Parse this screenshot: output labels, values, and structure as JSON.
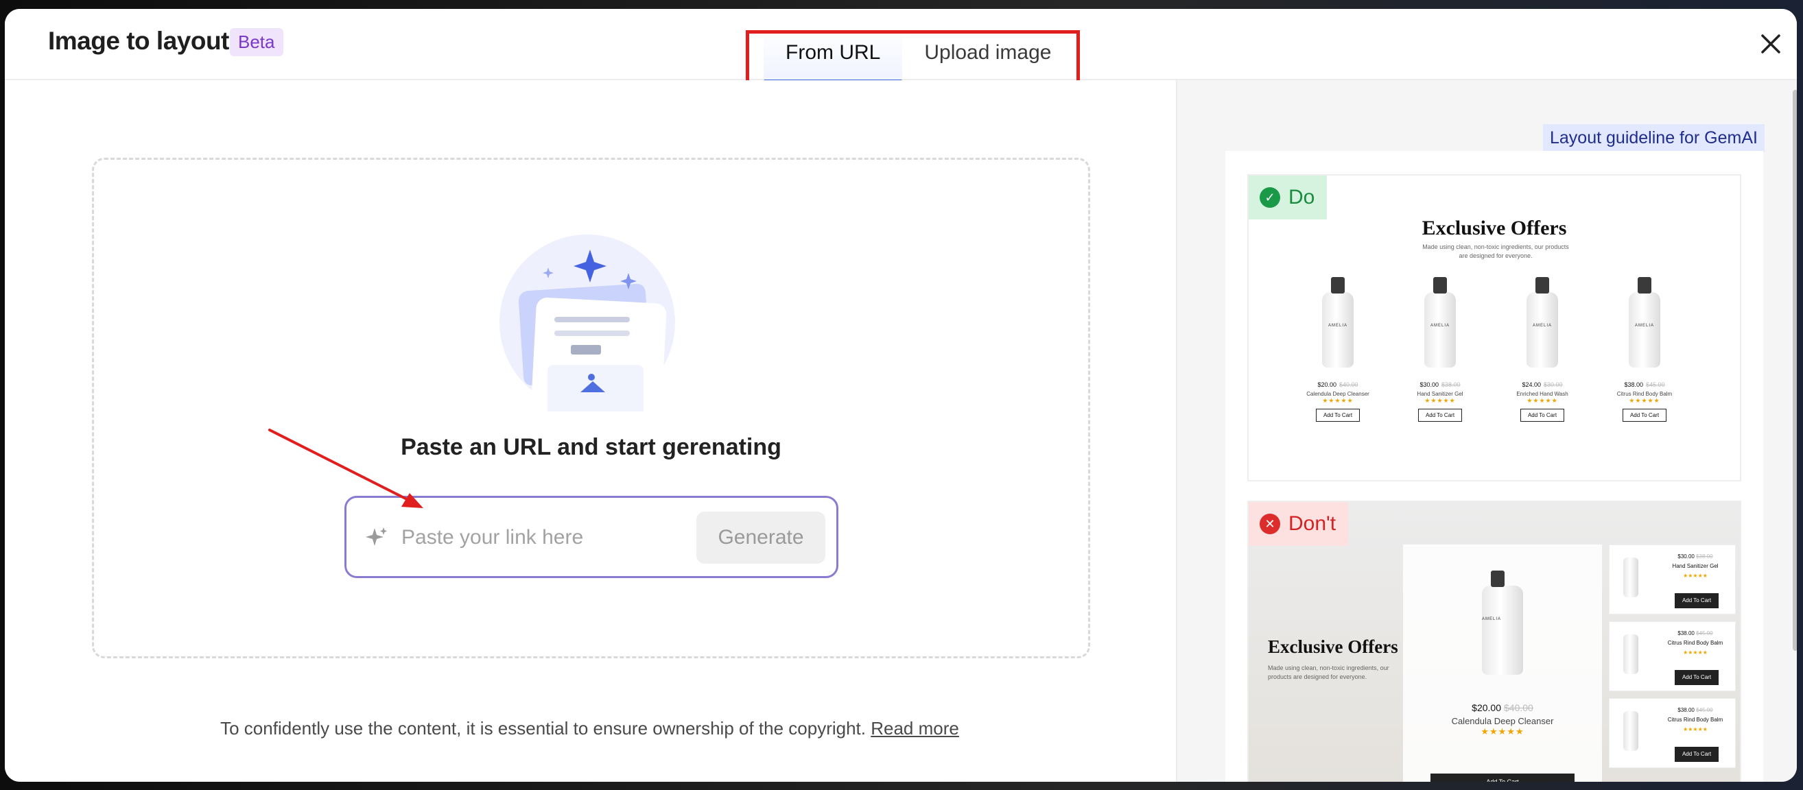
{
  "header": {
    "title": "Image to layout",
    "badge": "Beta",
    "tabs": [
      {
        "label": "From URL",
        "active": true
      },
      {
        "label": "Upload image",
        "active": false
      }
    ],
    "close_icon": "close-icon"
  },
  "main": {
    "prompt": "Paste an URL and start gerenating",
    "input_placeholder": "Paste your link here",
    "input_value": "",
    "generate_label": "Generate",
    "footer_text": "To confidently use the content, it is essential to ensure ownership of the copyright.",
    "footer_link": "Read more"
  },
  "guideline": {
    "label": "Layout guideline for GemAI",
    "do": {
      "badge": "Do",
      "title": "Exclusive Offers",
      "subtitle": "Made using clean, non-toxic ingredients, our products are designed for everyone.",
      "products": [
        {
          "brand": "AMELIA",
          "price": "$20.00",
          "old_price": "$40.00",
          "name": "Calendula Deep Cleanser",
          "stars": "★★★★★",
          "cta": "Add To Cart"
        },
        {
          "brand": "AMELIA",
          "price": "$30.00",
          "old_price": "$38.00",
          "name": "Hand Sanitizer Gel",
          "stars": "★★★★★",
          "cta": "Add To Cart"
        },
        {
          "brand": "AMELIA",
          "price": "$24.00",
          "old_price": "$30.00",
          "name": "Enriched Hand Wash",
          "stars": "★★★★★",
          "cta": "Add To Cart"
        },
        {
          "brand": "AMELIA",
          "price": "$38.00",
          "old_price": "$45.00",
          "name": "Citrus Rind Body Balm",
          "stars": "★★★★★",
          "cta": "Add To Cart"
        }
      ]
    },
    "dont": {
      "badge": "Don't",
      "title": "Exclusive Offers",
      "subtitle": "Made using clean, non-toxic ingredients, our products are designed for everyone.",
      "main_product": {
        "brand": "AMELIA",
        "price": "$20.00",
        "old_price": "$40.00",
        "name": "Calendula Deep Cleanser",
        "stars": "★★★★★",
        "cta": "Add To Cart"
      },
      "side_products": [
        {
          "price": "$30.00",
          "old_price": "$38.00",
          "name": "Hand Sanitizer Gel",
          "stars": "★★★★★",
          "cta": "Add To Cart"
        },
        {
          "price": "$38.00",
          "old_price": "$45.00",
          "name": "Citrus Rind Body Balm",
          "stars": "★★★★★",
          "cta": "Add To Cart"
        },
        {
          "price": "$38.00",
          "old_price": "$45.00",
          "name": "Citrus Rind Body Balm",
          "stars": "★★★★★",
          "cta": "Add To Cart"
        }
      ]
    }
  },
  "colors": {
    "accent": "#3c64d8",
    "highlight": "#e01e1e",
    "beta_bg": "#efe4fb",
    "do_green": "#1a9a48",
    "dont_red": "#dd2c2c"
  }
}
